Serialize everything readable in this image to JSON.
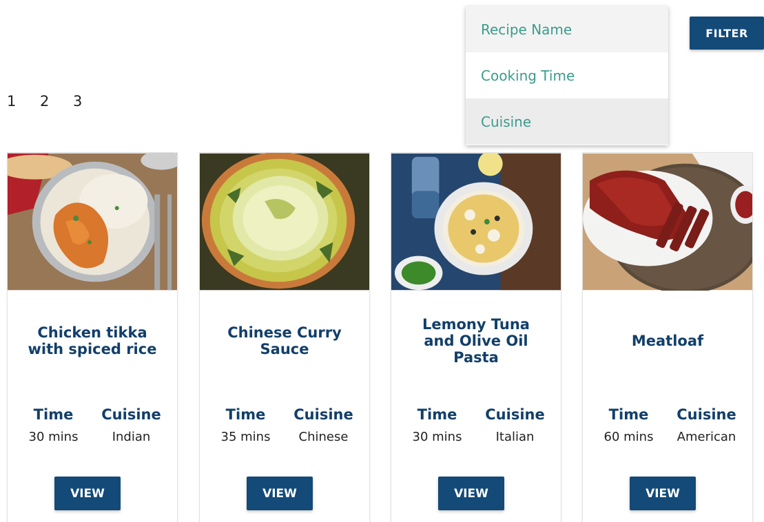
{
  "pagination": [
    "1",
    "2",
    "3"
  ],
  "filter_button": "FILTER",
  "sort_dropdown": {
    "options": [
      "Recipe Name",
      "Cooking Time",
      "Cuisine"
    ]
  },
  "stat_labels": {
    "time": "Time",
    "cuisine": "Cuisine"
  },
  "recipes": [
    {
      "title": "Chicken tikka with spiced rice",
      "time": "30 mins",
      "cuisine": "Indian",
      "button": "VIEW",
      "image_icon": "chicken-tikka-photo"
    },
    {
      "title": "Chinese Curry Sauce",
      "time": "35 mins",
      "cuisine": "Chinese",
      "button": "VIEW",
      "image_icon": "curry-rice-photo"
    },
    {
      "title": "Lemony Tuna and Olive Oil Pasta",
      "time": "30 mins",
      "cuisine": "Italian",
      "button": "VIEW",
      "image_icon": "tuna-pasta-photo"
    },
    {
      "title": "Meatloaf",
      "time": "60 mins",
      "cuisine": "American",
      "button": "VIEW",
      "image_icon": "meatloaf-photo"
    }
  ],
  "colors": {
    "primary": "#134a78",
    "title": "#123f6a",
    "dropdown_text": "#3a9c8c"
  }
}
